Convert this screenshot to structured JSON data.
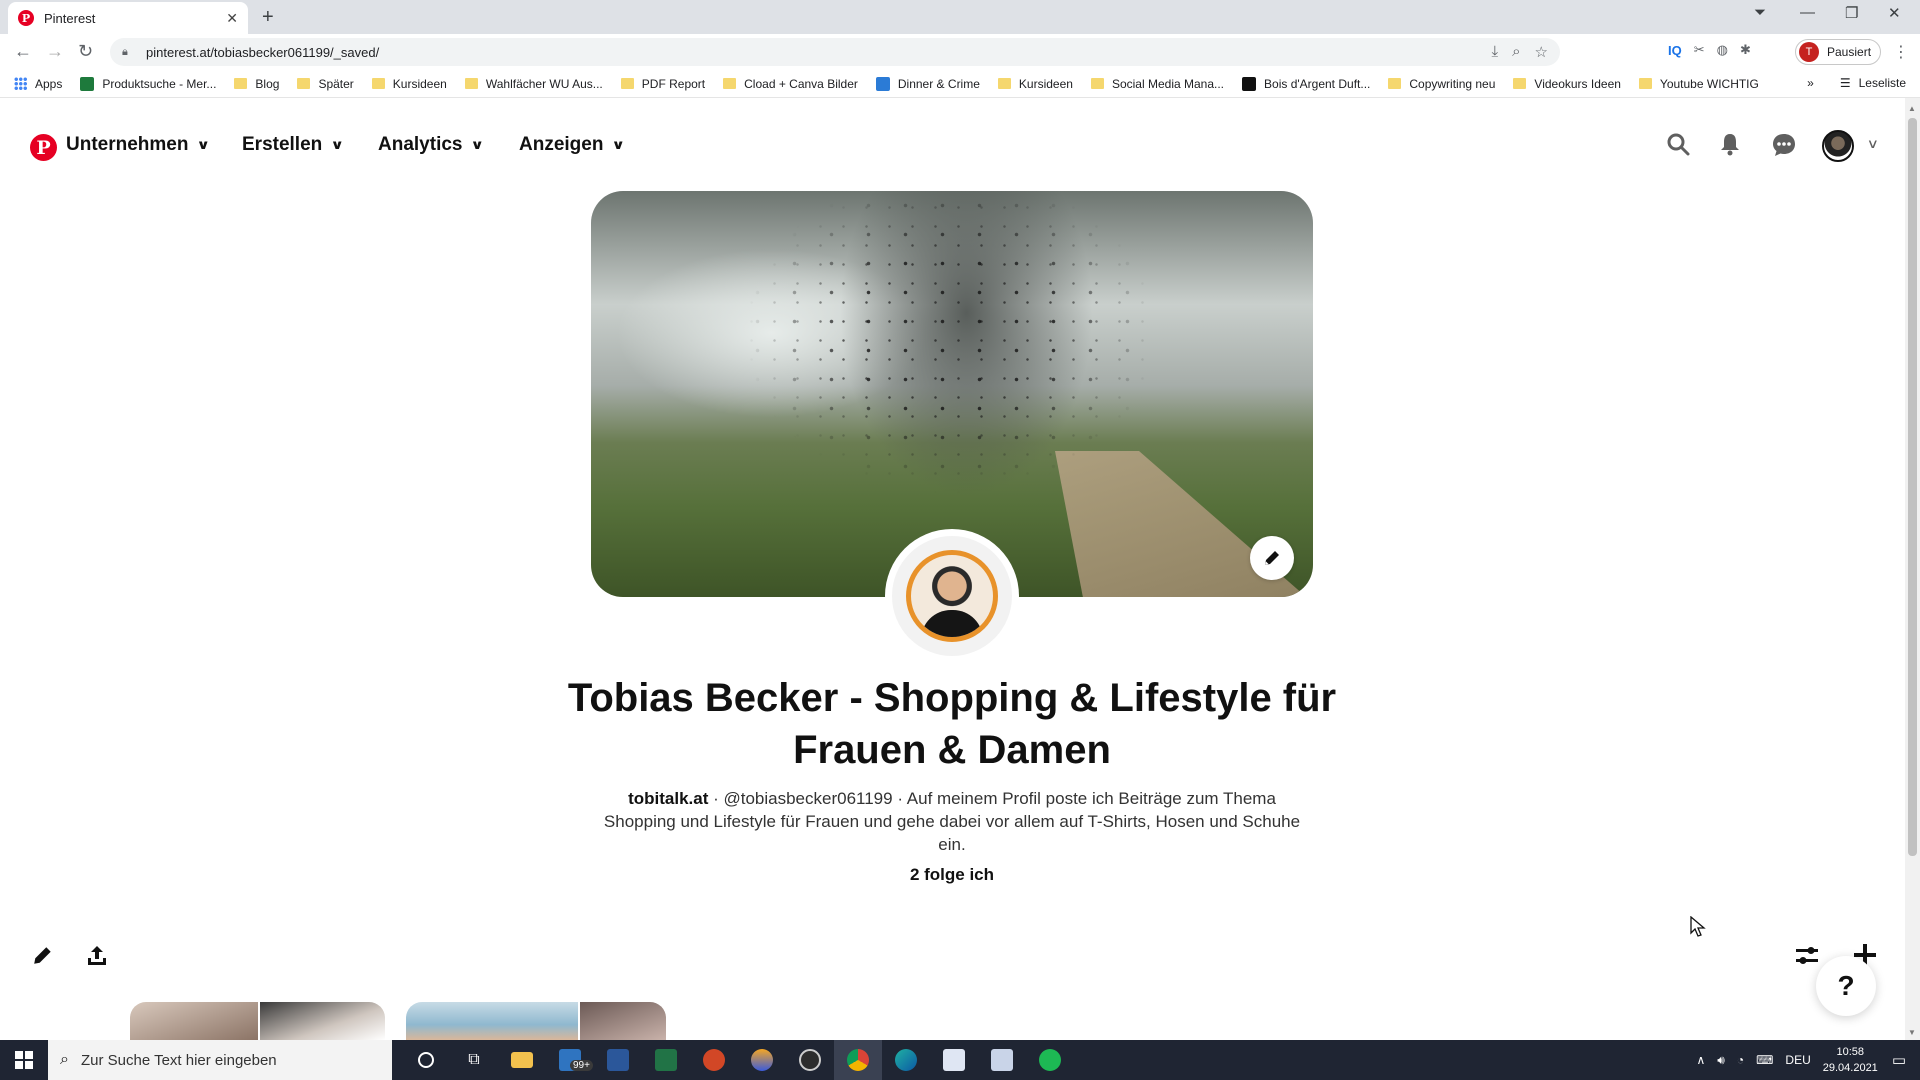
{
  "browser": {
    "tab_title": "Pinterest",
    "url": "pinterest.at/tobiasbecker061199/_saved/",
    "profile_label": "Pausiert",
    "profile_initial": "T",
    "bookmarks": [
      {
        "label": "Apps",
        "kind": "apps"
      },
      {
        "label": "Produktsuche - Mer...",
        "kind": "site",
        "color": "#1e7a3c"
      },
      {
        "label": "Blog",
        "kind": "folder"
      },
      {
        "label": "Später",
        "kind": "folder"
      },
      {
        "label": "Kursideen",
        "kind": "folder"
      },
      {
        "label": "Wahlfächer WU Aus...",
        "kind": "folder"
      },
      {
        "label": "PDF Report",
        "kind": "folder"
      },
      {
        "label": "Cload + Canva Bilder",
        "kind": "folder"
      },
      {
        "label": "Dinner & Crime",
        "kind": "site",
        "color": "#2b7bd6"
      },
      {
        "label": "Kursideen",
        "kind": "folder"
      },
      {
        "label": "Social Media Mana...",
        "kind": "folder"
      },
      {
        "label": "Bois d'Argent Duft...",
        "kind": "site",
        "color": "#111111"
      },
      {
        "label": "Copywriting neu",
        "kind": "folder"
      },
      {
        "label": "Videokurs Ideen",
        "kind": "folder"
      },
      {
        "label": "Youtube WICHTIG",
        "kind": "folder"
      }
    ],
    "more_bookmarks": "»",
    "reading_list": "Leseliste"
  },
  "header": {
    "nav": [
      {
        "label": "Unternehmen"
      },
      {
        "label": "Erstellen"
      },
      {
        "label": "Analytics"
      },
      {
        "label": "Anzeigen"
      }
    ],
    "icons": [
      "search-icon",
      "bell-icon",
      "chat-icon"
    ]
  },
  "profile": {
    "name": "Tobias Becker - Shopping & Lifestyle für Frauen & Damen",
    "website": "tobitalk.at",
    "separator": " · ",
    "handle": "@tobiasbecker061199",
    "bio": "Auf meinem Profil poste ich Beiträge zum Thema Shopping und Lifestyle für Frauen und gehe dabei vor allem auf T-Shirts, Hosen und Schuhe ein.",
    "following": "2 folge ich"
  },
  "help": {
    "label": "?"
  },
  "taskbar": {
    "search_placeholder": "Zur Suche Text hier eingeben",
    "mail_badge": "99+",
    "language": "DEU",
    "time": "10:58",
    "date": "29.04.2021"
  },
  "colors": {
    "pinterest_red": "#e60023",
    "avatar_ring": "#e8922a"
  }
}
